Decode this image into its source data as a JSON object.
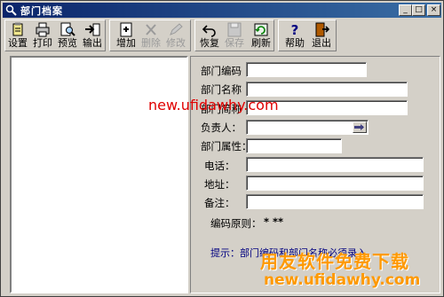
{
  "window": {
    "title": "部门档案",
    "btn_min": "_",
    "btn_max": "□",
    "btn_close": "×"
  },
  "toolbar": {
    "setup": "设置",
    "print": "打印",
    "preview": "预览",
    "export": "输出",
    "add": "增加",
    "delete": "删除",
    "modify": "修改",
    "restore": "恢复",
    "save": "保存",
    "refresh": "刷新",
    "help": "帮助",
    "exit": "退出"
  },
  "form": {
    "code_label": "部门编码",
    "code_value": "",
    "name_label": "部门名称",
    "name_value": "",
    "phone_label": "负责人：",
    "manager_value": "",
    "attr_label": "部门属性：",
    "attr_value": "",
    "tel_label": "电话：",
    "tel_value": "",
    "address_label": "地址：",
    "address_value": "",
    "remark_label": "备注：",
    "remark_value": "",
    "rule_label": "编码原则：",
    "rule_value": "* **",
    "hint": "提示：部门编码和部门名称必须录入"
  },
  "watermark": {
    "url_top": "new.ufidawhy.com",
    "brand": "用友软件免费下载",
    "url_bottom": "new.ufidawhy.com"
  },
  "colors": {
    "title_start": "#0a246a",
    "title_end": "#3a6ea5",
    "hint": "#000080",
    "wm_red": "#e00000",
    "wm_orange": "#ff9900"
  }
}
